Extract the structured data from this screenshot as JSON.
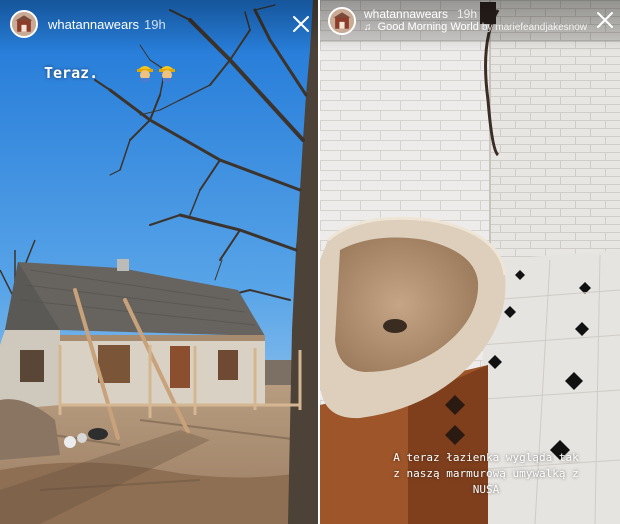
{
  "stories": [
    {
      "username": "whatannawears",
      "time": "19h",
      "caption": "Teraz.",
      "stickers": [
        "construction-worker-emoji",
        "construction-worker-emoji"
      ]
    },
    {
      "username": "whatannawears",
      "time": "19h",
      "music": {
        "song": "Good Morning World",
        "artist": "by mariefeandjakesnow"
      },
      "caption_lines": [
        "A teraz łazienka wygląda tak",
        "z naszą marmurową umywalką z",
        "NUSA"
      ]
    }
  ],
  "colors": {
    "sky": "#2f8be0",
    "ground": "#a88b6e",
    "tile": "#f1efec",
    "marble": "#d7c8b6",
    "wood": "#a0582c"
  }
}
